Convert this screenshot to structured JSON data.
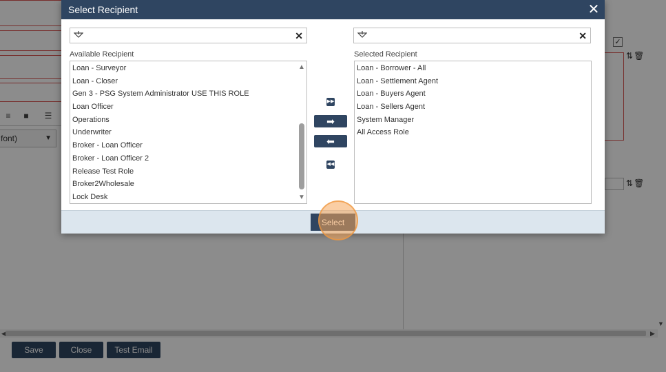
{
  "background": {
    "font_select_label": "font)",
    "footer_buttons": {
      "save": "Save",
      "close": "Close",
      "test_email": "Test Email"
    }
  },
  "modal": {
    "title": "Select Recipient",
    "available": {
      "label": "Available Recipient",
      "search_value": "",
      "items": [
        "Loan - Surveyor",
        "Loan - Closer",
        "Gen 3 - PSG System Administrator USE THIS ROLE",
        "Loan Officer",
        "Operations",
        "Underwriter",
        "Broker - Loan Officer",
        "Broker - Loan Officer 2",
        "Release Test Role",
        "Broker2Wholesale",
        "Lock Desk"
      ]
    },
    "selected": {
      "label": "Selected Recipient",
      "search_value": "",
      "items": [
        "Loan - Borrower - All",
        "Loan - Settlement Agent",
        "Loan - Buyers Agent",
        "Loan - Sellers Agent",
        "System Manager",
        "All Access Role"
      ]
    },
    "select_button": "Select"
  },
  "colors": {
    "header": "#2f4561",
    "footer": "#dce6ee",
    "click_indicator": "#f5a65a"
  }
}
